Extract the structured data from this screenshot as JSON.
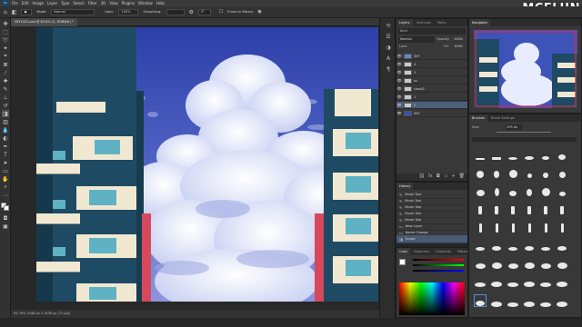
{
  "watermark": "MCELUN",
  "menu": {
    "items": [
      "File",
      "Edit",
      "Image",
      "Layer",
      "Type",
      "Select",
      "Filter",
      "3D",
      "View",
      "Plugins",
      "Window",
      "Help"
    ]
  },
  "options": {
    "mode_label": "Mode:",
    "mode_value": "Normal",
    "opacity_label": "Opac:",
    "opacity_value": "100%",
    "flow_label": "Smoothing:",
    "angle_value": "0°",
    "erase_label": "Erase to History"
  },
  "document": {
    "tab_title": "SKY1022.psd @ 63.8% (2, RGB/8#) *",
    "status_text": "63.76%   2048 px x 1638 px (72 ppi)"
  },
  "layers_panel": {
    "tabs": [
      "Layers",
      "Channels",
      "Paths"
    ],
    "filter_label": "Kind",
    "blend_mode": "Normal",
    "opacity_label": "Opacity:",
    "opacity_value": "100%",
    "lock_label": "Lock:",
    "fill_label": "Fill:",
    "fill_value": "100%",
    "layers": [
      {
        "name": "SKY",
        "selected": false
      },
      {
        "name": "4",
        "selected": false
      },
      {
        "name": "3",
        "selected": false
      },
      {
        "name": "ss",
        "selected": false
      },
      {
        "name": "cloud2",
        "selected": false
      },
      {
        "name": "1",
        "selected": false
      },
      {
        "name": "2",
        "selected": true
      },
      {
        "name": "SKY",
        "selected": false
      }
    ]
  },
  "history_panel": {
    "tabs": [
      "History"
    ],
    "items": [
      {
        "name": "Brush Tool",
        "selected": false
      },
      {
        "name": "Brush Tool",
        "selected": false
      },
      {
        "name": "Brush Tool",
        "selected": false
      },
      {
        "name": "Brush Tool",
        "selected": false
      },
      {
        "name": "Brush Tool",
        "selected": false
      },
      {
        "name": "New Layer",
        "selected": false
      },
      {
        "name": "Name Change",
        "selected": false
      },
      {
        "name": "Eraser",
        "selected": true
      }
    ]
  },
  "color_panel": {
    "tabs": [
      "Color",
      "Swatches",
      "Gradients",
      "Patterns"
    ]
  },
  "navigator_panel": {
    "tabs": [
      "Navigator"
    ]
  },
  "brushes_panel": {
    "tabs": [
      "Brushes",
      "Brush Settings"
    ],
    "size_label": "Size:",
    "size_value": "295 px"
  },
  "colors": {
    "accent_selection": "#4d5f7b",
    "sky": "#3a4fb3",
    "building_dark": "#1f4a63",
    "building_light": "#f1e8d2",
    "red_wall": "#d8485d"
  },
  "icons": {
    "tools": [
      "move-icon",
      "marquee-icon",
      "lasso-icon",
      "magic-wand-icon",
      "crop-icon",
      "eyedropper-icon",
      "healing-icon",
      "brush-icon",
      "stamp-icon",
      "history-brush-icon",
      "eraser-icon",
      "gradient-icon",
      "blur-icon",
      "dodge-icon",
      "pen-icon",
      "type-icon",
      "path-select-icon",
      "rectangle-icon",
      "hand-icon",
      "zoom-icon",
      "more-icon"
    ]
  }
}
